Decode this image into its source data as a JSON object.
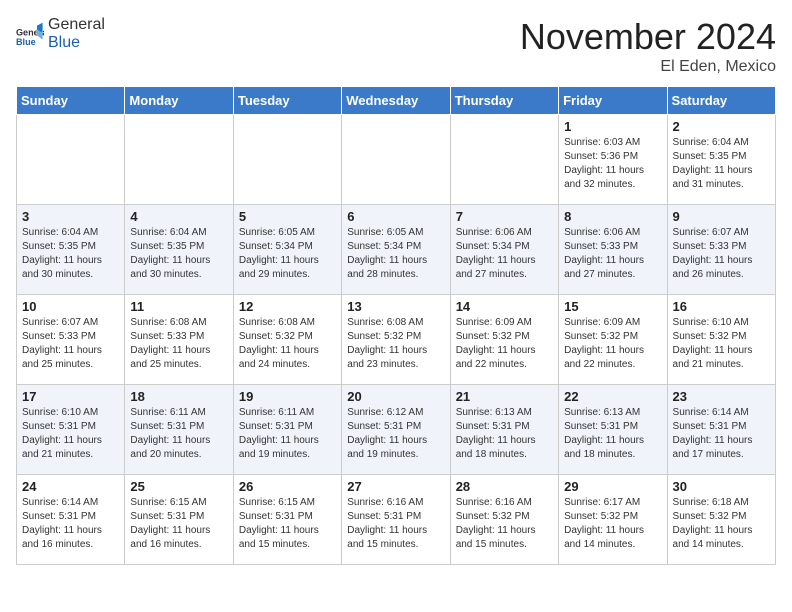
{
  "header": {
    "logo_general": "General",
    "logo_blue": "Blue",
    "month_title": "November 2024",
    "location": "El Eden, Mexico"
  },
  "weekdays": [
    "Sunday",
    "Monday",
    "Tuesday",
    "Wednesday",
    "Thursday",
    "Friday",
    "Saturday"
  ],
  "weeks": [
    [
      {
        "day": "",
        "info": ""
      },
      {
        "day": "",
        "info": ""
      },
      {
        "day": "",
        "info": ""
      },
      {
        "day": "",
        "info": ""
      },
      {
        "day": "",
        "info": ""
      },
      {
        "day": "1",
        "info": "Sunrise: 6:03 AM\nSunset: 5:36 PM\nDaylight: 11 hours\nand 32 minutes."
      },
      {
        "day": "2",
        "info": "Sunrise: 6:04 AM\nSunset: 5:35 PM\nDaylight: 11 hours\nand 31 minutes."
      }
    ],
    [
      {
        "day": "3",
        "info": "Sunrise: 6:04 AM\nSunset: 5:35 PM\nDaylight: 11 hours\nand 30 minutes."
      },
      {
        "day": "4",
        "info": "Sunrise: 6:04 AM\nSunset: 5:35 PM\nDaylight: 11 hours\nand 30 minutes."
      },
      {
        "day": "5",
        "info": "Sunrise: 6:05 AM\nSunset: 5:34 PM\nDaylight: 11 hours\nand 29 minutes."
      },
      {
        "day": "6",
        "info": "Sunrise: 6:05 AM\nSunset: 5:34 PM\nDaylight: 11 hours\nand 28 minutes."
      },
      {
        "day": "7",
        "info": "Sunrise: 6:06 AM\nSunset: 5:34 PM\nDaylight: 11 hours\nand 27 minutes."
      },
      {
        "day": "8",
        "info": "Sunrise: 6:06 AM\nSunset: 5:33 PM\nDaylight: 11 hours\nand 27 minutes."
      },
      {
        "day": "9",
        "info": "Sunrise: 6:07 AM\nSunset: 5:33 PM\nDaylight: 11 hours\nand 26 minutes."
      }
    ],
    [
      {
        "day": "10",
        "info": "Sunrise: 6:07 AM\nSunset: 5:33 PM\nDaylight: 11 hours\nand 25 minutes."
      },
      {
        "day": "11",
        "info": "Sunrise: 6:08 AM\nSunset: 5:33 PM\nDaylight: 11 hours\nand 25 minutes."
      },
      {
        "day": "12",
        "info": "Sunrise: 6:08 AM\nSunset: 5:32 PM\nDaylight: 11 hours\nand 24 minutes."
      },
      {
        "day": "13",
        "info": "Sunrise: 6:08 AM\nSunset: 5:32 PM\nDaylight: 11 hours\nand 23 minutes."
      },
      {
        "day": "14",
        "info": "Sunrise: 6:09 AM\nSunset: 5:32 PM\nDaylight: 11 hours\nand 22 minutes."
      },
      {
        "day": "15",
        "info": "Sunrise: 6:09 AM\nSunset: 5:32 PM\nDaylight: 11 hours\nand 22 minutes."
      },
      {
        "day": "16",
        "info": "Sunrise: 6:10 AM\nSunset: 5:32 PM\nDaylight: 11 hours\nand 21 minutes."
      }
    ],
    [
      {
        "day": "17",
        "info": "Sunrise: 6:10 AM\nSunset: 5:31 PM\nDaylight: 11 hours\nand 21 minutes."
      },
      {
        "day": "18",
        "info": "Sunrise: 6:11 AM\nSunset: 5:31 PM\nDaylight: 11 hours\nand 20 minutes."
      },
      {
        "day": "19",
        "info": "Sunrise: 6:11 AM\nSunset: 5:31 PM\nDaylight: 11 hours\nand 19 minutes."
      },
      {
        "day": "20",
        "info": "Sunrise: 6:12 AM\nSunset: 5:31 PM\nDaylight: 11 hours\nand 19 minutes."
      },
      {
        "day": "21",
        "info": "Sunrise: 6:13 AM\nSunset: 5:31 PM\nDaylight: 11 hours\nand 18 minutes."
      },
      {
        "day": "22",
        "info": "Sunrise: 6:13 AM\nSunset: 5:31 PM\nDaylight: 11 hours\nand 18 minutes."
      },
      {
        "day": "23",
        "info": "Sunrise: 6:14 AM\nSunset: 5:31 PM\nDaylight: 11 hours\nand 17 minutes."
      }
    ],
    [
      {
        "day": "24",
        "info": "Sunrise: 6:14 AM\nSunset: 5:31 PM\nDaylight: 11 hours\nand 16 minutes."
      },
      {
        "day": "25",
        "info": "Sunrise: 6:15 AM\nSunset: 5:31 PM\nDaylight: 11 hours\nand 16 minutes."
      },
      {
        "day": "26",
        "info": "Sunrise: 6:15 AM\nSunset: 5:31 PM\nDaylight: 11 hours\nand 15 minutes."
      },
      {
        "day": "27",
        "info": "Sunrise: 6:16 AM\nSunset: 5:31 PM\nDaylight: 11 hours\nand 15 minutes."
      },
      {
        "day": "28",
        "info": "Sunrise: 6:16 AM\nSunset: 5:32 PM\nDaylight: 11 hours\nand 15 minutes."
      },
      {
        "day": "29",
        "info": "Sunrise: 6:17 AM\nSunset: 5:32 PM\nDaylight: 11 hours\nand 14 minutes."
      },
      {
        "day": "30",
        "info": "Sunrise: 6:18 AM\nSunset: 5:32 PM\nDaylight: 11 hours\nand 14 minutes."
      }
    ]
  ]
}
